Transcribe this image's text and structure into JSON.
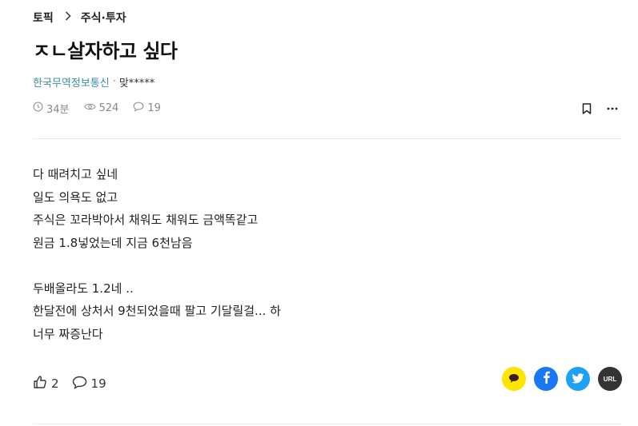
{
  "breadcrumb": {
    "root": "토픽",
    "current": "주식·투자"
  },
  "post": {
    "title": "ㅈㄴ살자하고 싶다",
    "company": "한국무역정보통신",
    "dot": "·",
    "author": "맞*****",
    "read_time": "34분",
    "views": "524",
    "comments": "19",
    "body_lines": [
      "다 때려치고 싶네",
      "일도 의욕도 없고",
      "주식은 꼬라박아서 채워도 채워도 금액똑같고",
      "원금 1.8넣었는데 지금 6천남음",
      "",
      "두배올라도 1.2네 ..",
      "한달전에 상처서 9천되었을때 팔고 기달릴걸... 하",
      "너무 짜증난다"
    ]
  },
  "reactions": {
    "likes": "2",
    "comments": "19"
  },
  "share": {
    "url_label": "URL"
  },
  "icons": {
    "clock": "clock-icon",
    "eye": "eye-icon",
    "comment": "comment-icon",
    "bookmark": "bookmark-icon",
    "more": "more-icon",
    "thumbs_up": "thumbs-up-icon",
    "kakao": "kakaotalk-icon",
    "facebook": "facebook-icon",
    "twitter": "twitter-icon"
  },
  "colors": {
    "company": "#3a8fa0",
    "kakao": "#fee500",
    "facebook": "#1877f2",
    "twitter": "#1da1f2",
    "url": "#333333"
  }
}
